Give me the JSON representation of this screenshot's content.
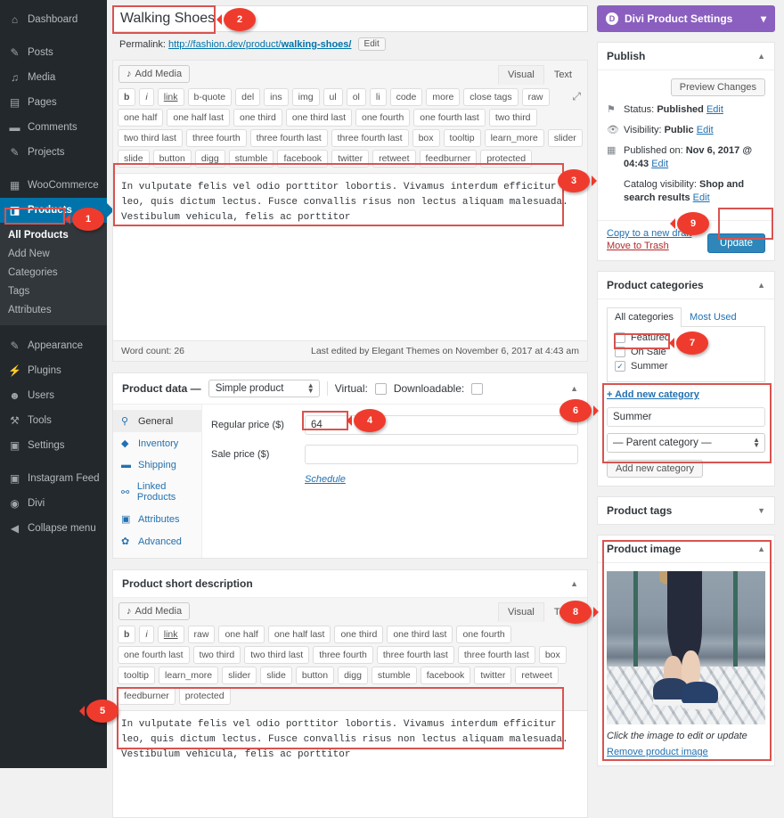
{
  "admin_menu": {
    "items": [
      {
        "label": "Dashboard",
        "icon": "dashboard-icon",
        "glyph": "⌂"
      },
      {
        "label": "Posts",
        "icon": "pin-icon",
        "glyph": "✎"
      },
      {
        "label": "Media",
        "icon": "media-icon",
        "glyph": "♫"
      },
      {
        "label": "Pages",
        "icon": "pages-icon",
        "glyph": "▤"
      },
      {
        "label": "Comments",
        "icon": "comments-icon",
        "glyph": "💬"
      },
      {
        "label": "Projects",
        "icon": "projects-icon",
        "glyph": "✎"
      },
      {
        "label": "WooCommerce",
        "icon": "woocommerce-icon",
        "glyph": "▦"
      },
      {
        "label": "Products",
        "icon": "products-icon",
        "glyph": "◨",
        "current": true
      }
    ],
    "products_submenu": [
      {
        "label": "All Products",
        "current": true
      },
      {
        "label": "Add New",
        "highlight": true
      },
      {
        "label": "Categories"
      },
      {
        "label": "Tags"
      },
      {
        "label": "Attributes"
      }
    ],
    "items_bottom": [
      {
        "label": "Appearance",
        "icon": "brush-icon",
        "glyph": "✎"
      },
      {
        "label": "Plugins",
        "icon": "plug-icon",
        "glyph": "⚡"
      },
      {
        "label": "Users",
        "icon": "users-icon",
        "glyph": "☻"
      },
      {
        "label": "Tools",
        "icon": "tools-icon",
        "glyph": "🔧"
      },
      {
        "label": "Settings",
        "icon": "settings-icon",
        "glyph": "▣"
      }
    ],
    "items_plugins": [
      {
        "label": "Instagram Feed",
        "icon": "camera-icon",
        "glyph": "▣"
      },
      {
        "label": "Divi",
        "icon": "divi-icon",
        "glyph": "◉"
      },
      {
        "label": "Collapse menu",
        "icon": "collapse-icon",
        "glyph": "◀"
      }
    ]
  },
  "post": {
    "title": "Walking Shoes",
    "permalink_label": "Permalink:",
    "permalink_prefix": "http://fashion.dev/product/",
    "permalink_slug": "walking-shoes/",
    "permalink_edit_label": "Edit"
  },
  "editor": {
    "add_media_label": "Add Media",
    "add_media_icon": "media-add-icon",
    "tab_visual": "Visual",
    "tab_text": "Text",
    "fullscreen_icon": "fullscreen-icon",
    "quicktags": [
      "b",
      "i",
      "link",
      "b-quote",
      "del",
      "ins",
      "img",
      "ul",
      "ol",
      "li",
      "code",
      "more",
      "close tags",
      "raw",
      "one half",
      "one half last",
      "one third",
      "one third last",
      "one fourth",
      "one fourth last",
      "two third",
      "two third last",
      "three fourth",
      "three fourth last",
      "three fourth last",
      "box",
      "tooltip",
      "learn_more",
      "slider",
      "slide",
      "button",
      "digg",
      "stumble",
      "facebook",
      "twitter",
      "retweet",
      "feedburner",
      "protected"
    ],
    "content": "In vulputate felis vel odio porttitor lobortis. Vivamus interdum efficitur leo, quis dictum lectus. Fusce convallis risus non lectus aliquam malesuada. Vestibulum vehicula, felis ac porttitor",
    "word_count": "Word count: 26",
    "last_edited": "Last edited by Elegant Themes on November 6, 2017 at 4:43 am"
  },
  "product_data": {
    "title": "Product data —",
    "type_selected": "Simple product",
    "virtual_label": "Virtual:",
    "downloadable_label": "Downloadable:",
    "tabs": [
      {
        "label": "General",
        "icon": "wrench-icon",
        "glyph": "⚲",
        "active": true
      },
      {
        "label": "Inventory",
        "icon": "tag-icon",
        "glyph": "◆"
      },
      {
        "label": "Shipping",
        "icon": "truck-icon",
        "glyph": "▬"
      },
      {
        "label": "Linked Products",
        "icon": "link-icon",
        "glyph": "⚯"
      },
      {
        "label": "Attributes",
        "icon": "grid-icon",
        "glyph": "▣"
      },
      {
        "label": "Advanced",
        "icon": "gear-icon",
        "glyph": "✿"
      }
    ],
    "regular_price_label": "Regular price ($)",
    "regular_price_value": "64",
    "sale_price_label": "Sale price ($)",
    "sale_price_value": "",
    "schedule_label": "Schedule"
  },
  "short_description": {
    "title": "Product short description",
    "add_media_label": "Add Media",
    "tab_visual": "Visual",
    "tab_text": "Text",
    "quicktags": [
      "b",
      "i",
      "link",
      "raw",
      "one half",
      "one half last",
      "one third",
      "one third last",
      "one fourth",
      "one fourth last",
      "two third",
      "two third last",
      "three fourth",
      "three fourth last",
      "three fourth last",
      "box",
      "tooltip",
      "learn_more",
      "slider",
      "slide",
      "button",
      "digg",
      "stumble",
      "facebook",
      "twitter",
      "retweet",
      "feedburner",
      "protected"
    ],
    "content": "In vulputate felis vel odio porttitor lobortis. Vivamus interdum efficitur leo, quis dictum lectus. Fusce convallis risus non lectus aliquam malesuada. Vestibulum vehicula, felis ac porttitor"
  },
  "divi_bar": {
    "label": "Divi Product Settings",
    "logo": "D",
    "chevron": "▾"
  },
  "publish": {
    "title": "Publish",
    "preview_label": "Preview Changes",
    "status_label": "Status:",
    "status_value": "Published",
    "status_edit": "Edit",
    "visibility_label": "Visibility:",
    "visibility_value": "Public",
    "visibility_edit": "Edit",
    "published_label": "Published on:",
    "published_value": "Nov 6, 2017 @ 04:43",
    "published_edit": "Edit",
    "catalog_label": "Catalog visibility:",
    "catalog_value": "Shop and search results",
    "catalog_edit": "Edit",
    "copy_draft": "Copy to a new draft",
    "move_trash": "Move to Trash",
    "update_label": "Update"
  },
  "categories": {
    "title": "Product categories",
    "tab_all": "All categories",
    "tab_most_used": "Most Used",
    "items": [
      {
        "label": "Featured",
        "checked": false
      },
      {
        "label": "On Sale",
        "checked": false
      },
      {
        "label": "Summer",
        "checked": true
      }
    ],
    "add_new_link": "+ Add new category",
    "new_name_value": "Summer",
    "parent_selected": "— Parent category —",
    "add_button": "Add new category"
  },
  "tags": {
    "title": "Product tags"
  },
  "product_image": {
    "title": "Product image",
    "caption": "Click the image to edit or update",
    "remove_label": "Remove product image"
  },
  "callouts": [
    {
      "n": "1"
    },
    {
      "n": "2"
    },
    {
      "n": "3"
    },
    {
      "n": "4"
    },
    {
      "n": "5"
    },
    {
      "n": "6"
    },
    {
      "n": "7"
    },
    {
      "n": "8"
    },
    {
      "n": "9"
    }
  ],
  "colors": {
    "admin_bg": "#23282d",
    "admin_submenu": "#32373c",
    "current_blue": "#0073aa",
    "divi_purple": "#8a5fbf",
    "highlight_red": "#d9534f",
    "callout_red": "#ef3b2d",
    "link_blue": "#2271b1",
    "primary_button": "#2e87b8"
  }
}
